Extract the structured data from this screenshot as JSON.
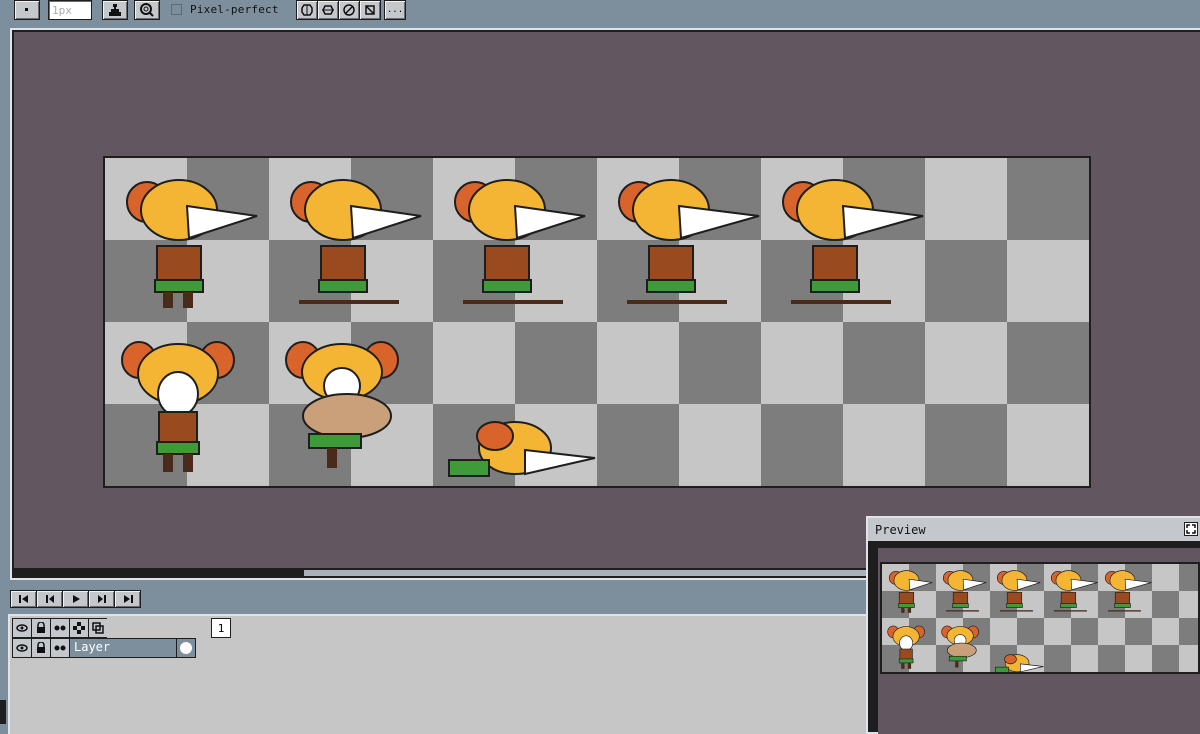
{
  "toolbar": {
    "brush_size_value": "1px",
    "pixel_perfect_label": "Pixel-perfect",
    "pixel_perfect_checked": false,
    "more_label": "...",
    "icons": [
      "square-brush-icon",
      "ink-icon",
      "zoom-icon",
      "symmetry-horizontal-icon",
      "symmetry-vertical-icon",
      "rotate-icon",
      "flip-icon"
    ]
  },
  "timeline": {
    "playback_icons": [
      "first-frame-icon",
      "previous-frame-icon",
      "play-icon",
      "next-frame-icon",
      "last-frame-icon"
    ],
    "header_icons": [
      "eye-icon",
      "lock-icon",
      "continuous-icon",
      "link-icon",
      "onion-skin-icon"
    ],
    "frame_number": "1",
    "layer_name": "Layer",
    "layer_icons": [
      "eye-icon",
      "lock-icon",
      "continuous-icon"
    ]
  },
  "preview": {
    "title": "Preview"
  },
  "colors": {
    "accent": "#7d8f9c",
    "canvas_bg": "#625660",
    "checker_dark": "#7d7d7d",
    "checker_light": "#c6c6c6",
    "sprite_hair": "#f4b534",
    "sprite_fur": "#d8642c",
    "sprite_outline": "#1e1e1e",
    "sprite_skirt": "#3f9a3a",
    "sprite_body": "#9a4a1f"
  }
}
